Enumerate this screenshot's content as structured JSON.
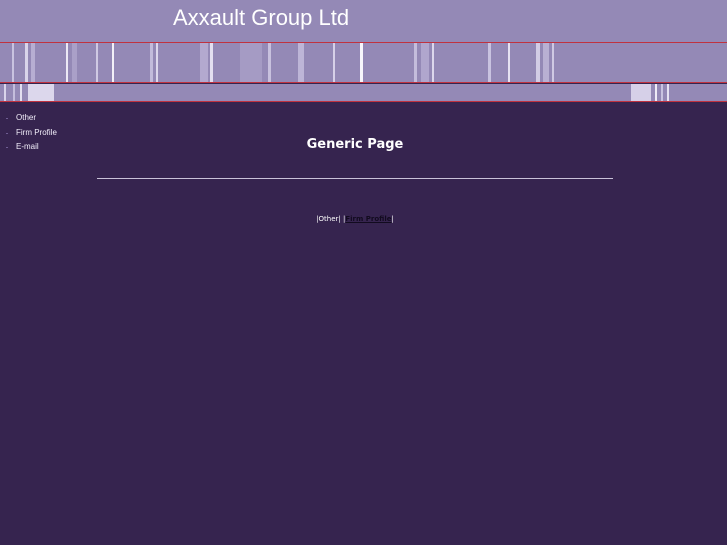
{
  "header": {
    "title": "Axxault Group Ltd"
  },
  "sidebar": {
    "items": [
      {
        "label": "Other"
      },
      {
        "label": "Firm Profile"
      },
      {
        "label": "E-mail"
      }
    ]
  },
  "main": {
    "title": "Generic Page"
  },
  "footer_nav": {
    "sep_open": "|",
    "current": "Other",
    "sep_mid": "| |",
    "link_label": "Firm Profile",
    "sep_close": "|"
  },
  "colors": {
    "background": "#36244f",
    "header": "#9489b6",
    "accent_rule": "#c0323f",
    "text": "#ffffff"
  }
}
